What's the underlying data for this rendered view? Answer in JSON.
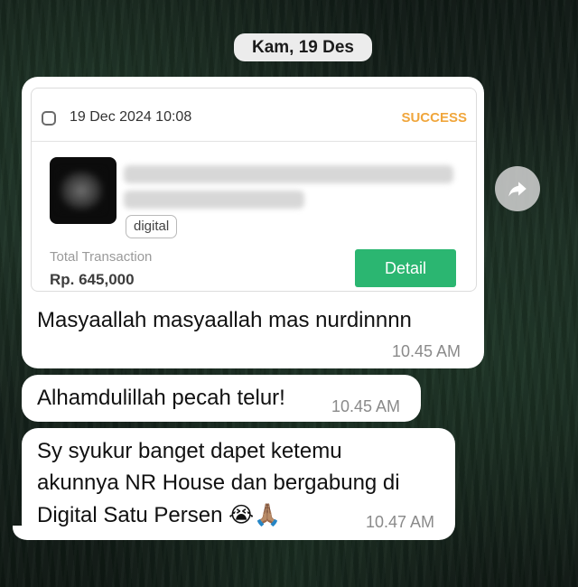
{
  "chat": {
    "date_separator": "Kam, 19 Des"
  },
  "transaction_card": {
    "date": "19 Dec 2024 10:08",
    "status": "SUCCESS",
    "tag": "digital",
    "total_label": "Total Transaction",
    "total_amount": "Rp. 645,000",
    "detail_button": "Detail"
  },
  "messages": [
    {
      "text": "Masyaallah masyaallah mas nurdinnnn",
      "time": "10.45 AM"
    },
    {
      "text": "Alhamdulillah pecah telur!",
      "time": "10.45 AM"
    },
    {
      "lines": [
        "Sy syukur banget dapet ketemu",
        "akunnya NR House dan bergabung di",
        "Digital Satu Persen"
      ],
      "emoji": "😭🙏🏽",
      "time": "10.47 AM"
    }
  ],
  "icons": {
    "forward": "forward-arrow-icon",
    "checkbox": "checkbox-icon"
  },
  "colors": {
    "status": "#f0a63c",
    "detail_button": "#2bb671",
    "bubble": "#ffffff"
  }
}
